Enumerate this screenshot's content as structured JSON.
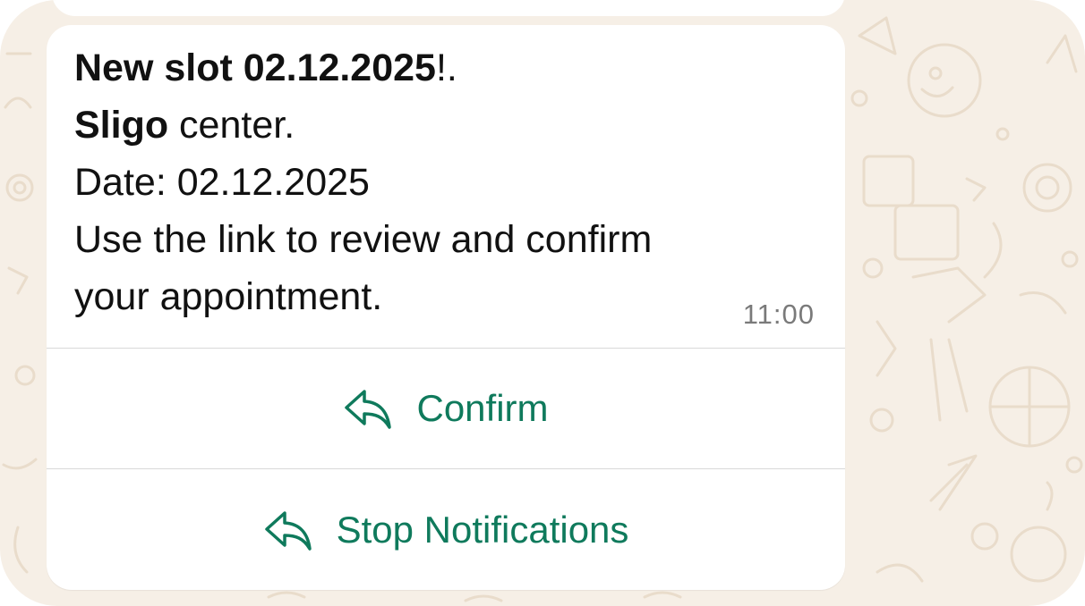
{
  "message": {
    "line1_bold": "New slot 02.12.2025",
    "line1_rest": "!.",
    "line2_bold": "Sligo",
    "line2_rest": " center.",
    "line3": "Date: 02.12.2025",
    "line4": "Use the link to review and confirm",
    "line5": "your appointment.",
    "time": "11:00"
  },
  "actions": [
    {
      "label": "Confirm",
      "icon": "reply-icon"
    },
    {
      "label": "Stop Notifications",
      "icon": "reply-icon"
    }
  ],
  "colors": {
    "chat_background": "#f6efe6",
    "bubble": "#ffffff",
    "action_text": "#0f7a5c",
    "timestamp": "#7a7a7a"
  }
}
